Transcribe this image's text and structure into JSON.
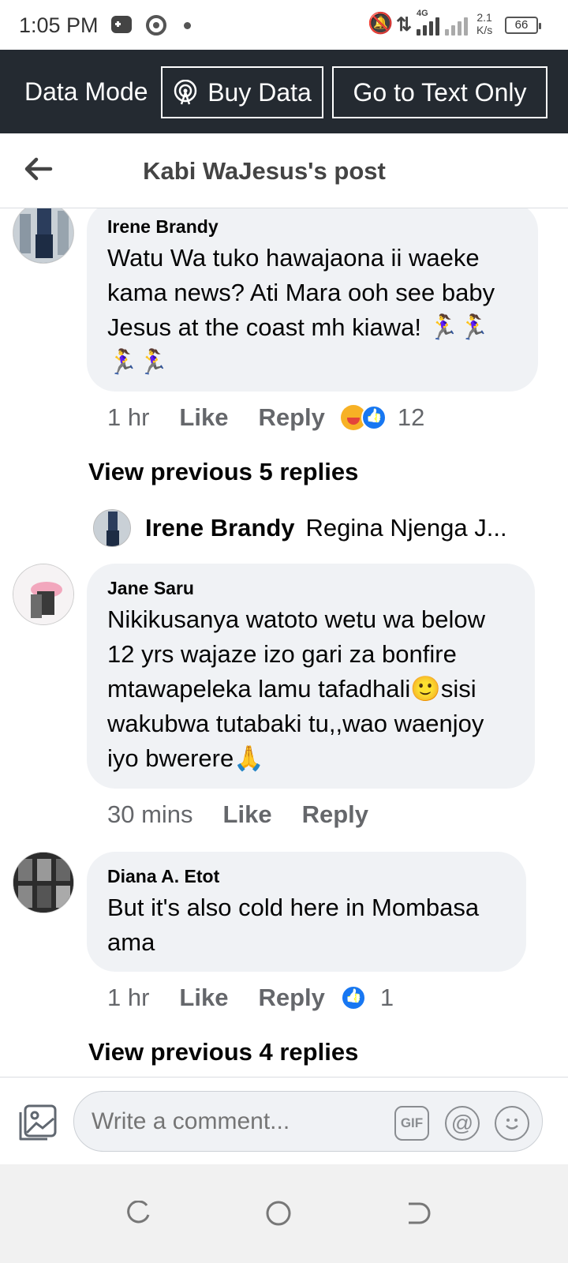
{
  "status_bar": {
    "time": "1:05 PM",
    "network": "4G",
    "speed_value": "2.1",
    "speed_unit": "K/s",
    "battery": "66",
    "icons": [
      "game-icon",
      "chrome-icon",
      "dot-icon",
      "bell-off-icon",
      "data-arrows-icon",
      "signal-icon",
      "battery-icon"
    ]
  },
  "data_bar": {
    "mode_label": "Data Mode",
    "buy_label": "Buy Data",
    "text_only_label": "Go to Text Only"
  },
  "header": {
    "title": "Kabi WaJesus's post"
  },
  "comments": [
    {
      "author": "Irene Brandy",
      "text": "Watu Wa tuko hawajaona ii waeke kama news? Ati Mara ooh see baby Jesus at the coast mh kiawa! 🏃‍♀️🏃‍♀️🏃‍♀️🏃‍♀️",
      "time": "1 hr",
      "like_label": "Like",
      "reply_label": "Reply",
      "reaction_count": "12",
      "reactions": [
        "laugh",
        "like"
      ]
    },
    {
      "author": "Jane Saru",
      "text": "Nikikusanya watoto wetu wa below 12 yrs wajaze izo gari za bonfire mtawapeleka lamu tafadhali🙂sisi wakubwa tutabaki tu,,wao waenjoy iyo bwerere🙏",
      "time": "30 mins",
      "like_label": "Like",
      "reply_label": "Reply",
      "reaction_count": "",
      "reactions": []
    },
    {
      "author": "Diana A. Etot",
      "text": "But it's also cold here in Mombasa ama",
      "time": "1 hr",
      "like_label": "Like",
      "reply_label": "Reply",
      "reaction_count": "1",
      "reactions": [
        "like"
      ]
    }
  ],
  "view_previous_1": "View previous 5 replies",
  "reply_preview": {
    "author": "Irene Brandy",
    "text": "Regina Njenga J..."
  },
  "view_previous_2": "View previous 4 replies",
  "composer": {
    "placeholder": "Write a comment...",
    "gif_label": "GIF",
    "at_label": "@"
  },
  "colors": {
    "data_bar_bg": "#242a31",
    "bubble_bg": "#f0f2f5",
    "like_blue": "#1877f2",
    "meta_gray": "#65676b"
  }
}
